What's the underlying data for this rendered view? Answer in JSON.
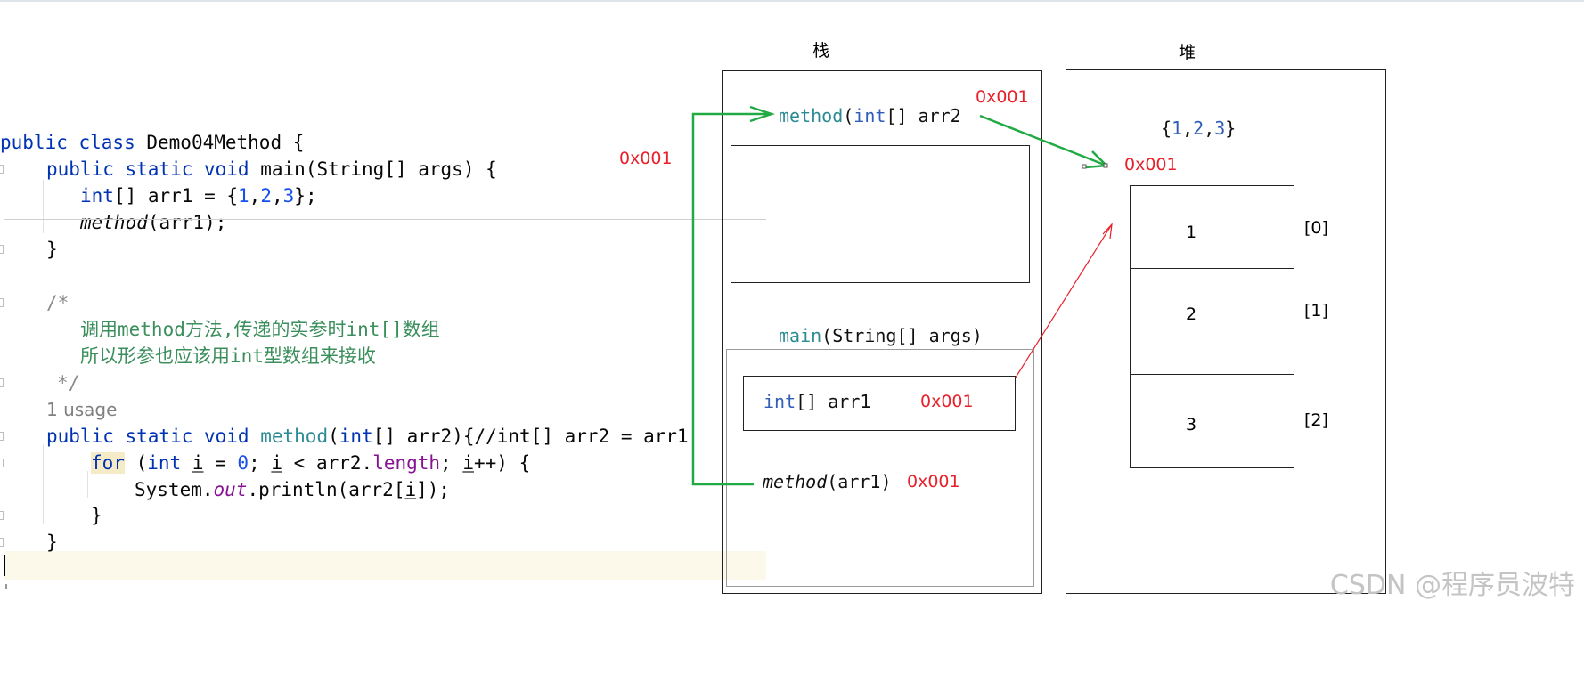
{
  "code": {
    "class_line": {
      "kw": "public class",
      "name": "Demo04Method {"
    },
    "main_sig": {
      "kw": "public static void",
      "name": "main",
      "params": "(String[] args) {"
    },
    "arr_decl": {
      "kw": "int",
      "rest_a": "[] arr1 = {",
      "n1": "1",
      "c1": ",",
      "n2": "2",
      "c2": ",",
      "n3": "3",
      "rest_b": "};"
    },
    "call": {
      "name": "method",
      "args": "(arr1);"
    },
    "close_main": "}",
    "comment_open": "/*",
    "comment_line1": "调用method方法,传递的实参时int[]数组",
    "comment_line2": "所以形参也应该用int型数组来接收",
    "comment_close": "*/",
    "usage_hint": "1 usage",
    "method_sig": {
      "kw": "public static void",
      "name": "method",
      "open": "(",
      "type": "int",
      "rest": "[] arr2){//int[] arr2 = arr1"
    },
    "for_line": {
      "kw": "for",
      "p1": " (",
      "int": "int",
      "sp": " ",
      "i1": "i",
      "eq": " = ",
      "zero": "0",
      "semi": "; ",
      "i2": "i",
      "lt": " < arr2.",
      "len": "length",
      "semi2": "; ",
      "i3": "i",
      "tail": "++) {"
    },
    "print_line": {
      "a": "System.",
      "out": "out",
      "b": ".println(arr2[",
      "i": "i",
      "c": "]);"
    },
    "close_for": "}",
    "close_method": "}",
    "addr_label": "0x001"
  },
  "diagram": {
    "stack_title": "栈",
    "heap_title": "堆",
    "method_frame": {
      "name": "method",
      "open": "(",
      "type": "int",
      "rest": "[] arr2",
      "addr": "0x001"
    },
    "main_frame": {
      "name": "main",
      "rest": "(String[] args)"
    },
    "main_var": {
      "type": "int",
      "rest": "[] arr1",
      "addr": "0x001"
    },
    "main_call": {
      "name": "method",
      "rest": "(arr1)",
      "addr": "0x001"
    },
    "heap_literal": {
      "a": "{",
      "n1": "1",
      "c1": ",",
      "n2": "2",
      "c2": ",",
      "n3": "3",
      "b": "}"
    },
    "heap_addr": "0x001",
    "cells": [
      {
        "value": "1",
        "index": "[0]"
      },
      {
        "value": "2",
        "index": "[1]"
      },
      {
        "value": "3",
        "index": "[2]"
      }
    ],
    "watermark": "CSDN @程序员波特",
    "colors": {
      "green_arrow": "#22aa44",
      "red_arrow": "#e8202a",
      "address": "#e8202a"
    }
  }
}
